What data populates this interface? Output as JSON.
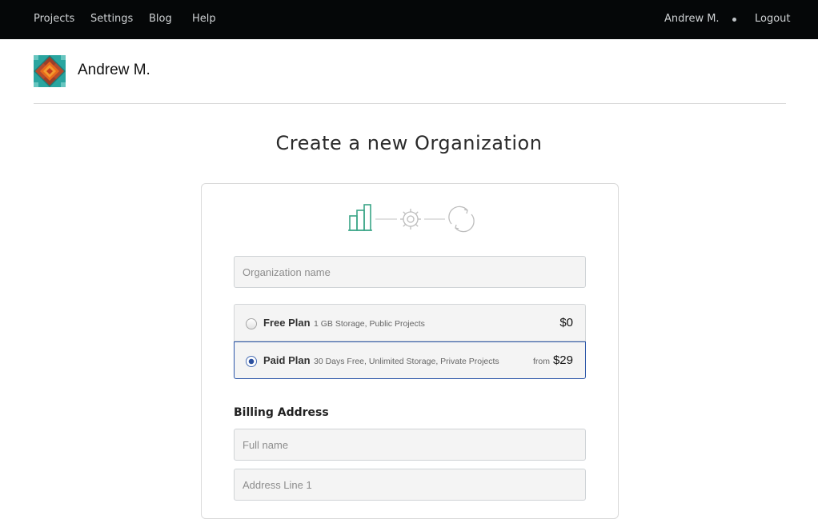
{
  "nav": {
    "links": [
      "Projects",
      "Settings",
      "Blog",
      "Help"
    ],
    "user": "Andrew M.",
    "logout": "Logout"
  },
  "profile": {
    "name": "Andrew M.",
    "avatar_icon": "geometric-avatar-icon"
  },
  "page": {
    "title": "Create a new Organization"
  },
  "steps": [
    "building-icon",
    "gear-icon",
    "refresh-icon"
  ],
  "form": {
    "org_name_placeholder": "Organization name",
    "plans": [
      {
        "name": "Free Plan",
        "desc": "1 GB Storage, Public Projects",
        "price": "$0",
        "selected": false
      },
      {
        "name": "Paid Plan",
        "desc": "30 Days Free, Unlimited Storage, Private Projects",
        "from": "from",
        "price": "$29",
        "selected": true
      }
    ],
    "billing_title": "Billing Address",
    "full_name_placeholder": "Full name",
    "address1_placeholder": "Address Line 1"
  },
  "colors": {
    "nav_bg": "#050708",
    "accent": "#2b56a8",
    "step_active": "#3aa587",
    "step_inactive": "#b9b9b9"
  }
}
